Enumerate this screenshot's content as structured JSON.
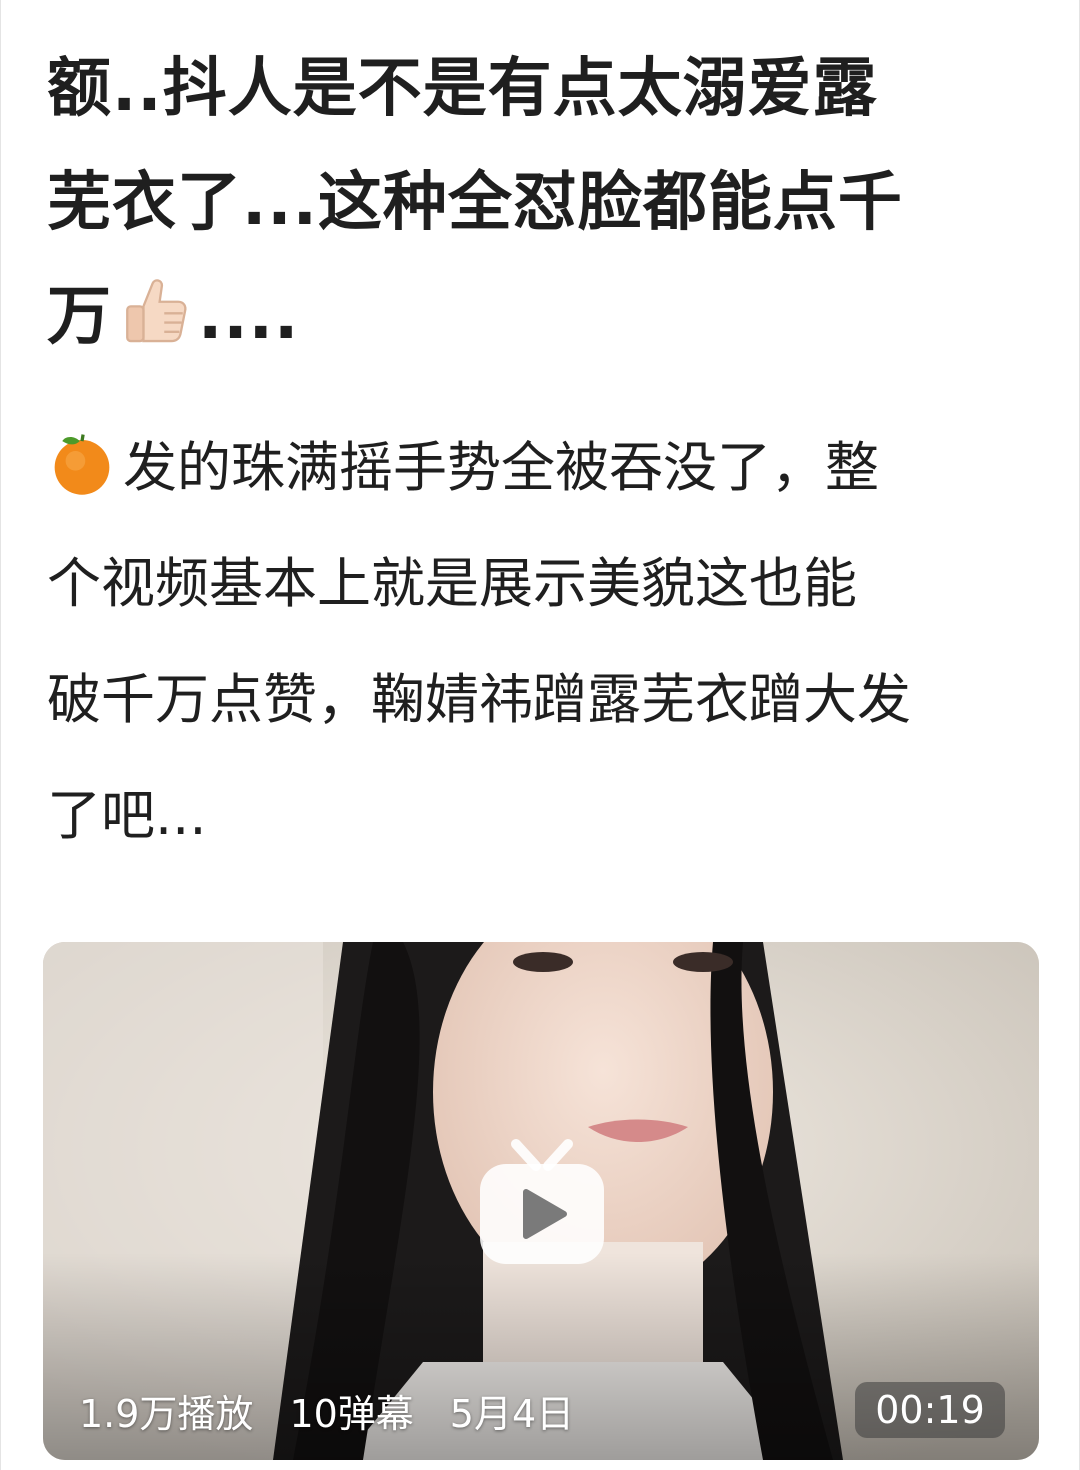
{
  "post": {
    "title_line1": "额..抖人是不是有点太溺爱露",
    "title_line2": "芜衣了...这种全怼脸都能点千",
    "title_line3a": "万",
    "title_line3b": "....",
    "title_emoji": "thumbs-up-icon",
    "body_emoji": "tangerine-icon",
    "body_line1": "发的珠满摇手势全被吞没了，整",
    "body_line2": "个视频基本上就是展示美貌",
    "body_line2b": "这也能",
    "body_line3": "破千万点赞，鞠婧祎蹭露芜衣蹭大发",
    "body_line4": "了吧..."
  },
  "video": {
    "plays": "1.9万播放",
    "danmaku": "10弹幕",
    "date": "5月4日",
    "duration": "00:19",
    "play_icon": "tv-play-icon"
  },
  "colors": {
    "text": "#1f1f1f",
    "background": "#ffffff"
  }
}
